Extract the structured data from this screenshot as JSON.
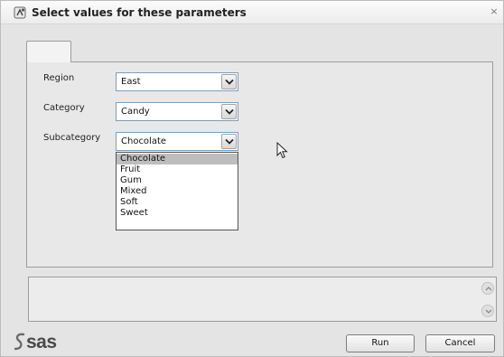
{
  "window": {
    "title": "Select values for these parameters",
    "close_glyph": "×"
  },
  "tab": {
    "label": ""
  },
  "fields": [
    {
      "label": "Region",
      "value": "East"
    },
    {
      "label": "Category",
      "value": "Candy"
    },
    {
      "label": "Subcategory",
      "value": "Chocolate"
    }
  ],
  "dropdown": {
    "open_for": "Subcategory",
    "selected": "Chocolate",
    "options": [
      "Chocolate",
      "Fruit",
      "Gum",
      "Mixed",
      "Soft",
      "Sweet"
    ]
  },
  "log": {
    "text": ""
  },
  "footer": {
    "logo_text": "sas",
    "run_label": "Run",
    "cancel_label": "Cancel"
  },
  "icons": {
    "title": "sas-app-icon",
    "close": "close-icon",
    "combo_arrow": "chevron-down-icon",
    "scroll_up": "chevron-up-icon",
    "scroll_down": "chevron-down-icon",
    "pointer": "mouse-pointer-icon"
  },
  "colors": {
    "dialog_bg": "#e4e4e4",
    "combo_border": "#7f9db9",
    "selected_option_bg": "#bdbdbd"
  }
}
